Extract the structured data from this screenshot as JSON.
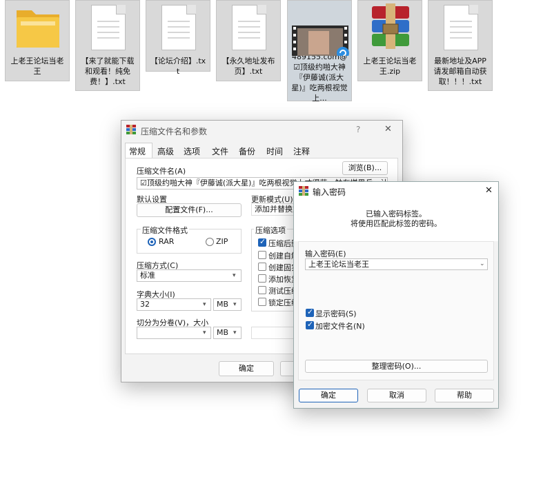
{
  "desktop": {
    "files": [
      {
        "label": "上老王论坛当老王",
        "icon": "folder-icon"
      },
      {
        "label": "【来了就能下载和观看！纯免费！】.txt",
        "icon": "text-file-icon"
      },
      {
        "label": "【论坛介绍】.txt",
        "icon": "text-file-icon"
      },
      {
        "label": "【永久地址发布页】.txt",
        "icon": "text-file-icon"
      },
      {
        "label": "489155.com@☑顶级约啪大神『伊藤诚(派大星)』吃两根视觉上...",
        "icon": "video-file-icon"
      },
      {
        "label": "上老王论坛当老王.zip",
        "icon": "winrar-archive-icon"
      },
      {
        "label": "最新地址及APP请发邮箱自动获取！！！.txt",
        "icon": "text-file-icon"
      }
    ]
  },
  "archive_dialog": {
    "title": "压缩文件名和参数",
    "help": "?",
    "close": "✕",
    "tabs": [
      "常规",
      "高级",
      "选项",
      "文件",
      "备份",
      "时间",
      "注释"
    ],
    "archive_name_label": "压缩文件名(A)",
    "browse_button": "浏览(B)...",
    "archive_name_value": "☑顶级约啪大神『伊藤诚(派大星)』吃两根视觉上才得获一触在堪思兵，让目单更",
    "default_settings_label": "默认设置",
    "profiles_button": "配置文件(F)...",
    "update_mode_label": "更新模式(U)",
    "update_mode_value": "添加并替换文",
    "format_group": "压缩文件格式",
    "format_rar": "RAR",
    "format_zip": "ZIP",
    "method_label": "压缩方式(C)",
    "method_value": "标准",
    "dict_label": "字典大小(I)",
    "dict_value": "32",
    "dict_unit": "MB",
    "split_label": "切分为分卷(V)，大小",
    "split_unit": "MB",
    "options_group": "压缩选项",
    "options": [
      {
        "label": "压缩后删",
        "checked": true
      },
      {
        "label": "创建自解",
        "checked": false
      },
      {
        "label": "创建固实",
        "checked": false
      },
      {
        "label": "添加恢复",
        "checked": false
      },
      {
        "label": "测试压缩",
        "checked": false
      },
      {
        "label": "锁定压缩",
        "checked": false
      }
    ],
    "ok_button": "确定"
  },
  "password_dialog": {
    "title": "输入密码",
    "close": "✕",
    "message_line1": "已输入密码标签。",
    "message_line2": "将使用匹配此标签的密码。",
    "password_label": "输入密码(E)",
    "password_value": "上老王论坛当老王",
    "show_password": "显示密码(S)",
    "encrypt_names": "加密文件名(N)",
    "organize_button": "整理密码(O)...",
    "ok_button": "确定",
    "cancel_button": "取消",
    "help_button": "帮助"
  },
  "colors": {
    "accent": "#1e63b8",
    "folder": "#f5c542"
  }
}
